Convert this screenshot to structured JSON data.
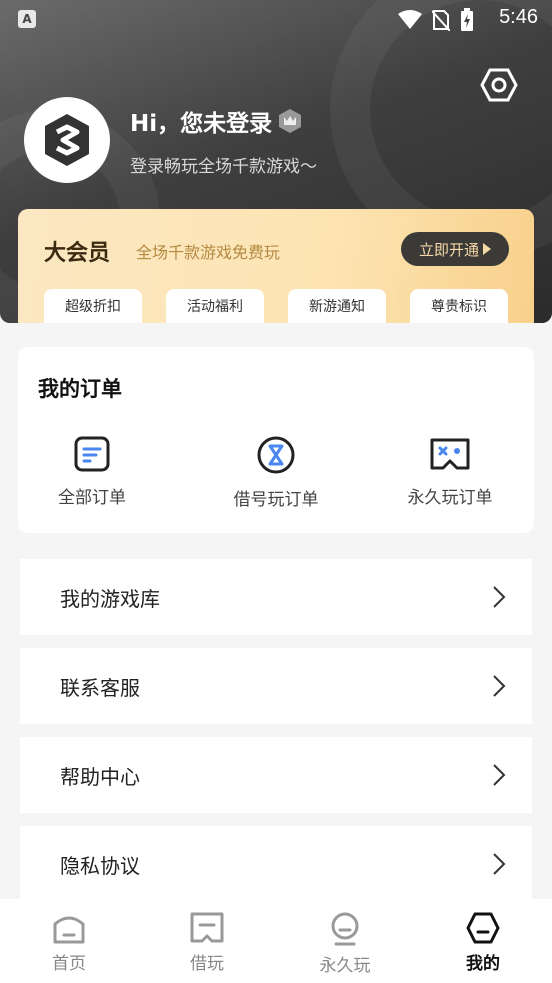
{
  "status_bar": {
    "time": "5:46"
  },
  "profile": {
    "greeting": "Hi，您未登录",
    "subtitle": "登录畅玩全场千款游戏～"
  },
  "vip": {
    "title": "大会员",
    "description": "全场千款游戏免费玩",
    "button_label": "立即开通",
    "perks": [
      "超级折扣",
      "活动福利",
      "新游通知",
      "尊贵标识"
    ]
  },
  "orders": {
    "title": "我的订单",
    "items": [
      {
        "label": "全部订单",
        "icon": "document-icon"
      },
      {
        "label": "借号玩订单",
        "icon": "hourglass-icon"
      },
      {
        "label": "永久玩订单",
        "icon": "gamepad-icon"
      }
    ]
  },
  "menu": {
    "items": [
      "我的游戏库",
      "联系客服",
      "帮助中心",
      "隐私协议"
    ]
  },
  "tabbar": {
    "items": [
      {
        "label": "首页",
        "icon": "home-icon"
      },
      {
        "label": "借玩",
        "icon": "borrow-icon"
      },
      {
        "label": "永久玩",
        "icon": "forever-icon"
      },
      {
        "label": "我的",
        "icon": "profile-icon"
      }
    ],
    "active_index": 3
  },
  "colors": {
    "header_dark": "#3f3f3f",
    "vip_gold": "#f8d08b",
    "accent_blue": "#4a86f0"
  }
}
